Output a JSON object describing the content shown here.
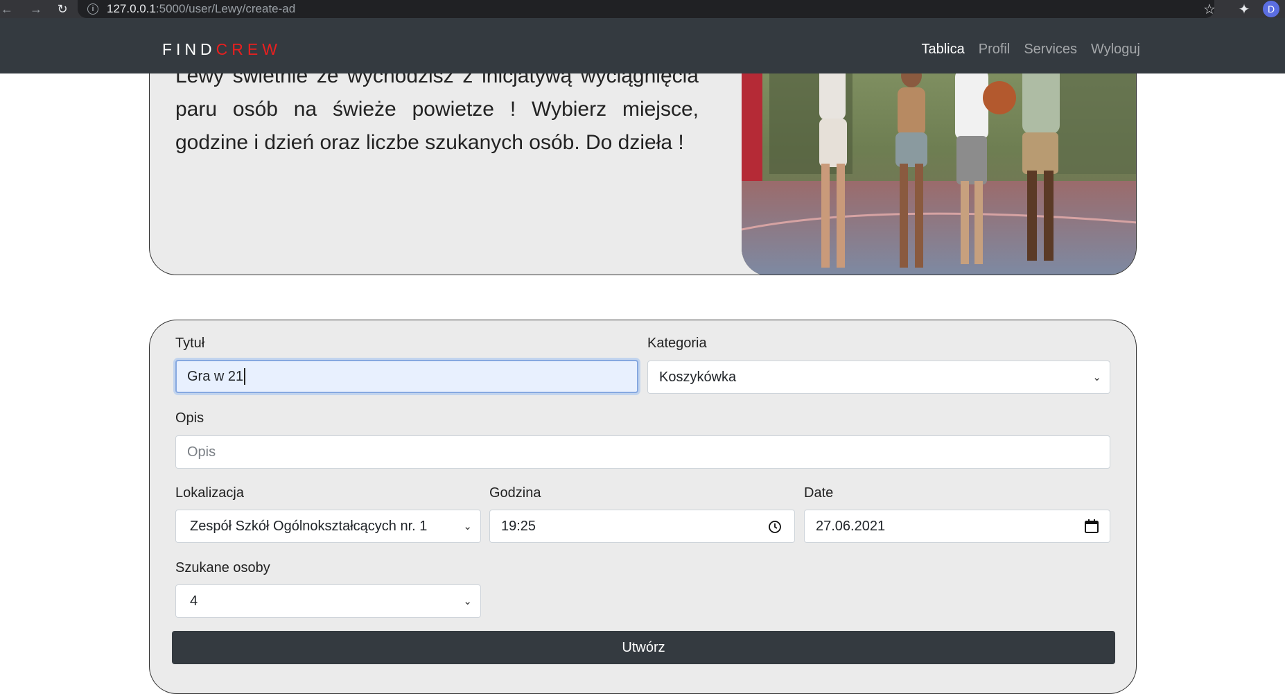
{
  "browser": {
    "url_host": "127.0.0.1",
    "url_path": ":5000/user/Lewy/create-ad",
    "profile_initial": "D"
  },
  "navbar": {
    "brand_part1": "FIND",
    "brand_part2": "CREW",
    "links": [
      "Tablica",
      "Profil",
      "Services",
      "Wyloguj"
    ],
    "active_link": "Tablica"
  },
  "hero": {
    "text": "Lewy świetnie że wychodzisz z inicjatywą wyciągnięcia paru osób na świeże powietze ! Wybierz miejsce, godzine i dzień oraz liczbe szukanych osób. Do dzieła !"
  },
  "form": {
    "title_label": "Tytuł",
    "title_value": "Gra w 21",
    "category_label": "Kategoria",
    "category_value": "Koszykówka",
    "description_label": "Opis",
    "description_placeholder": "Opis",
    "location_label": "Lokalizacja",
    "location_value": "Zespół Szkół Ogólnokształcących nr. 1",
    "time_label": "Godzina",
    "time_value": "19:25",
    "date_label": "Date",
    "date_value": "27.06.2021",
    "people_label": "Szukane osoby",
    "people_value": "4",
    "submit_label": "Utwórz"
  },
  "colors": {
    "navbar_bg": "#343a40",
    "brand_accent": "#ea1f1f",
    "card_bg": "#ebebeb",
    "button_bg": "#343a40"
  }
}
